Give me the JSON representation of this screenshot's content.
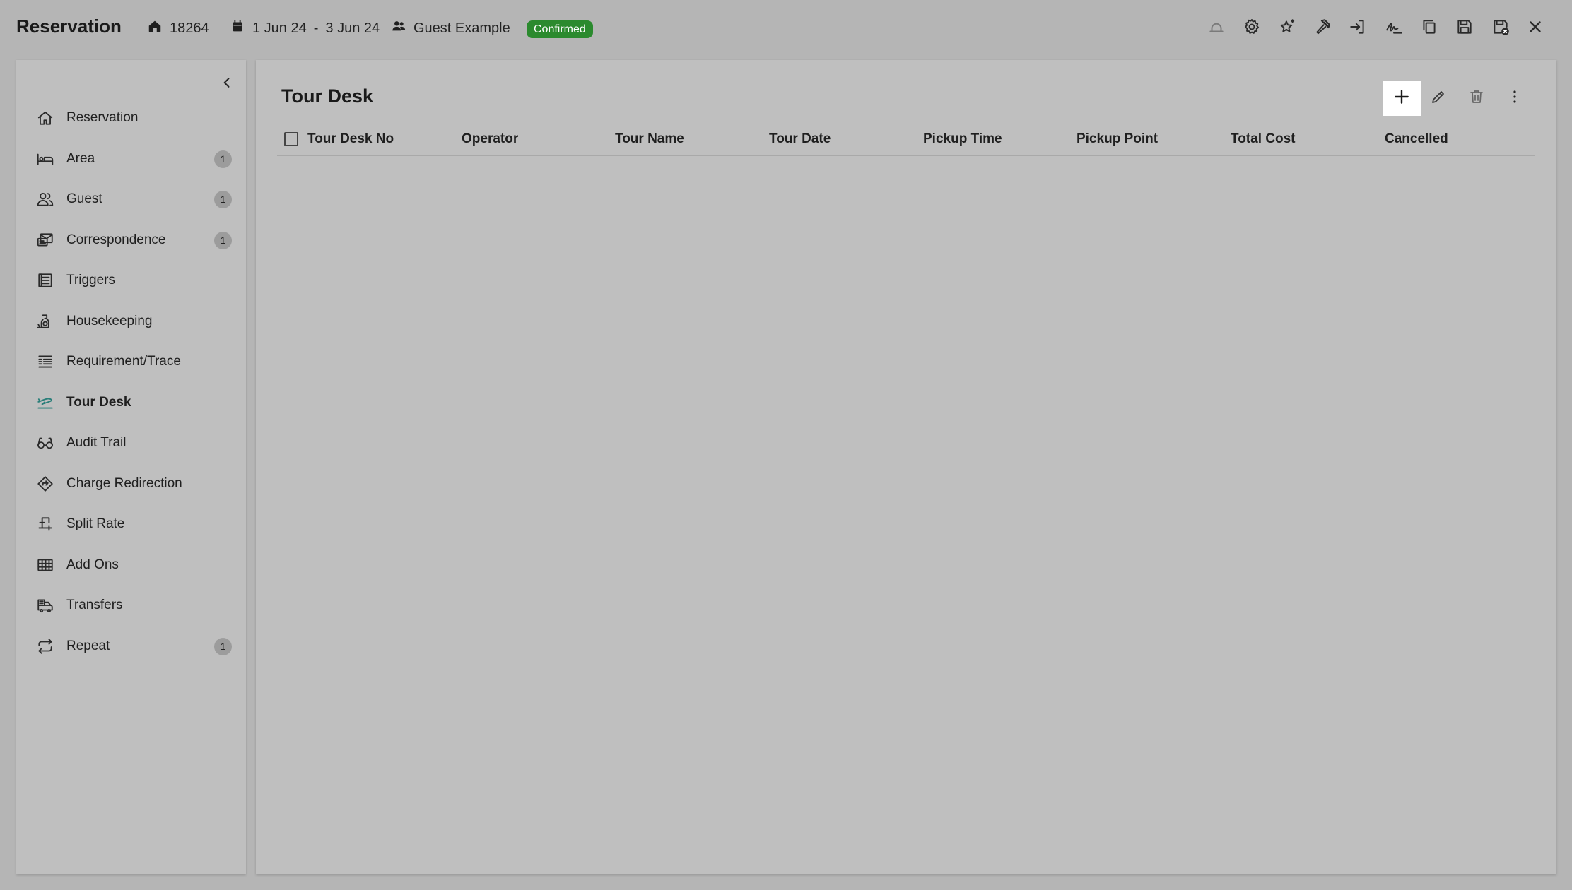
{
  "header": {
    "title": "Reservation",
    "reservation_no": "18264",
    "date_from": "1 Jun 24",
    "date_separator": "-",
    "date_to": "3 Jun 24",
    "guest_name": "Guest Example",
    "status": "Confirmed",
    "status_color": "#2b8a2e",
    "actions": [
      "bell-icon",
      "gear-icon",
      "sparkle-star-icon",
      "hammer-icon",
      "sign-in-icon",
      "signature-icon",
      "copy-icon",
      "save-icon",
      "save-close-icon",
      "close-icon"
    ]
  },
  "sidebar": {
    "items": [
      {
        "label": "Reservation",
        "icon": "home-icon"
      },
      {
        "label": "Area",
        "icon": "bed-icon",
        "count": "1"
      },
      {
        "label": "Guest",
        "icon": "users-icon",
        "count": "1"
      },
      {
        "label": "Correspondence",
        "icon": "correspondence-icon",
        "count": "1"
      },
      {
        "label": "Triggers",
        "icon": "triggers-icon"
      },
      {
        "label": "Housekeeping",
        "icon": "housekeeping-icon"
      },
      {
        "label": "Requirement/Trace",
        "icon": "list-icon"
      },
      {
        "label": "Tour Desk",
        "icon": "plane-icon",
        "active": true
      },
      {
        "label": "Audit Trail",
        "icon": "glasses-icon"
      },
      {
        "label": "Charge Redirection",
        "icon": "diamond-arrow-icon"
      },
      {
        "label": "Split Rate",
        "icon": "split-icon"
      },
      {
        "label": "Add Ons",
        "icon": "grid-icon"
      },
      {
        "label": "Transfers",
        "icon": "bus-icon"
      },
      {
        "label": "Repeat",
        "icon": "repeat-icon",
        "count": "1"
      }
    ],
    "active_color": "#2b7f7a"
  },
  "main": {
    "title": "Tour Desk",
    "columns": [
      "Tour Desk No",
      "Operator",
      "Tour Name",
      "Tour Date",
      "Pickup Time",
      "Pickup Point",
      "Total Cost",
      "Cancelled"
    ],
    "rows": []
  }
}
